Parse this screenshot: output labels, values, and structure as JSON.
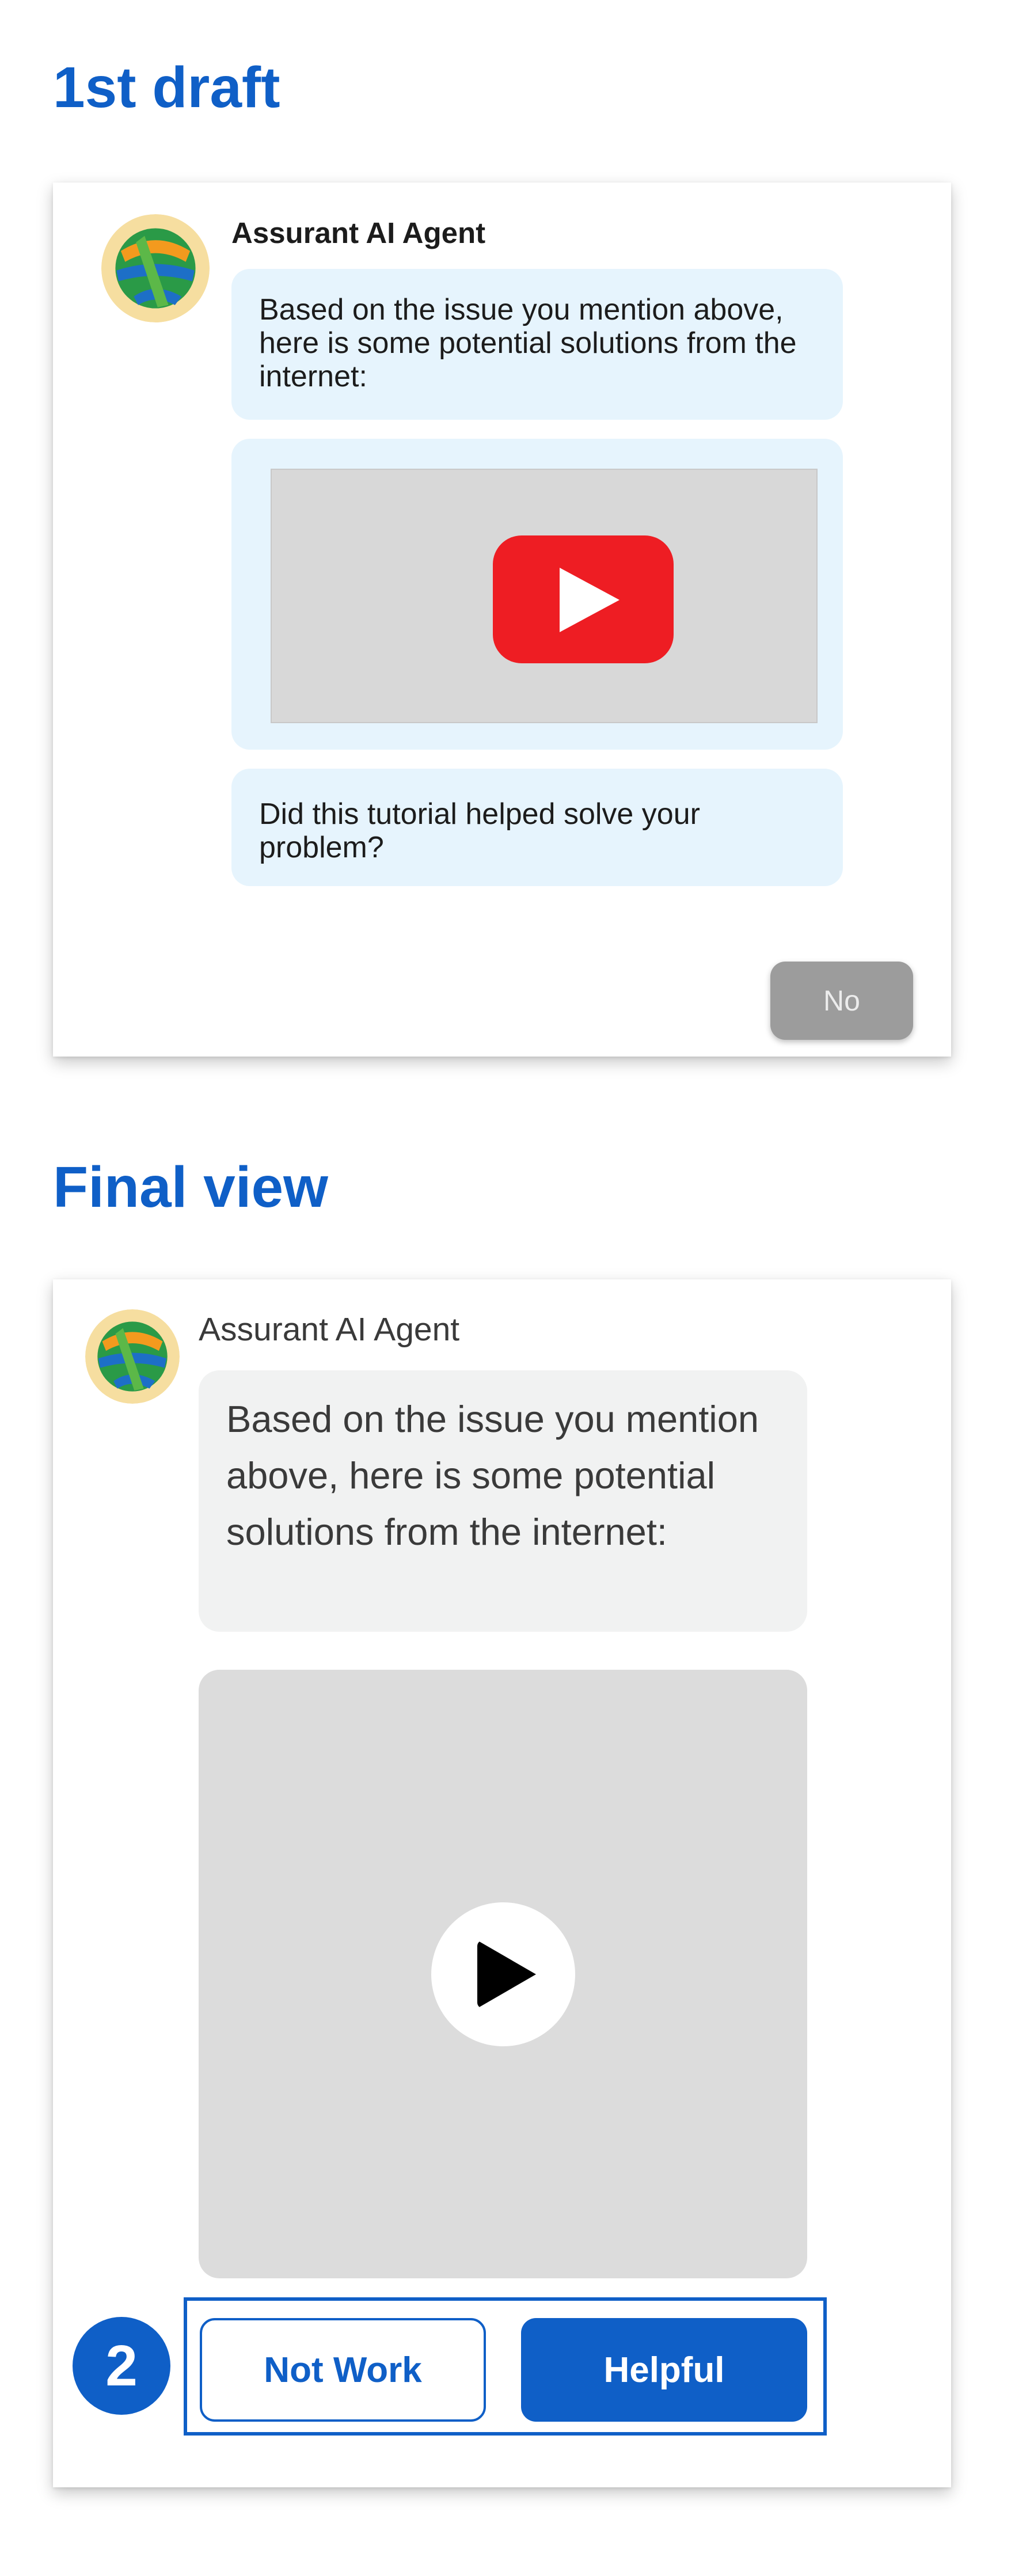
{
  "sections": {
    "draft_title": "1st draft",
    "final_title": "Final view"
  },
  "draft": {
    "agent_name": "Assurant AI Agent",
    "intro_message": "Based on the issue you mention above, here is some potential solutions from the internet:",
    "video_icon": "youtube-play-icon",
    "question_message": "Did this tutorial helped solve your problem?",
    "no_label": "No"
  },
  "final": {
    "agent_name": "Assurant AI Agent",
    "intro_message": "Based on the issue you mention above, here is some potential solutions from the internet:",
    "video_icon": "play-icon",
    "step_number": "2",
    "not_work_label": "Not Work",
    "helpful_label": "Helpful"
  },
  "colors": {
    "brand_blue": "#0f5fc7",
    "draft_bubble": "#e6f4fd",
    "final_bubble": "#f1f2f2",
    "youtube_red": "#ee1d23",
    "disabled_button": "#9c9c9c"
  }
}
